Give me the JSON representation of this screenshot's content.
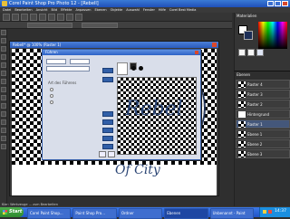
{
  "window": {
    "title": "Corel Paint Shop Pro Photo 12 - [Rebell]"
  },
  "menu": [
    "Datei",
    "Bearbeiten",
    "Ansicht",
    "Bild",
    "Effekte",
    "Anpassen",
    "Ebenen",
    "Objekte",
    "Auswahl",
    "Fenster",
    "Hilfe",
    "Corel Best Media"
  ],
  "document": {
    "title": "Rebell* @ 100% (Raster 1)"
  },
  "dialog": {
    "title": "Führen",
    "section": "Art des Führens"
  },
  "canvas_art": {
    "brand": "Rebel",
    "tagline": "Of City"
  },
  "palette": {
    "title": "Materialien"
  },
  "layers": {
    "title": "Ebenen",
    "items": [
      "Raster 4",
      "Raster 3",
      "Raster 2",
      "Hintergrund",
      "Raster 1",
      "Ebene 1",
      "Ebene 2",
      "Ebene 3"
    ]
  },
  "statusbar": {
    "text": "Klar: Werkzeuge ... zum Bearbeiten"
  },
  "taskbar": {
    "start": "Start",
    "tasks": [
      "Corel Paint Shop...",
      "Paint Shop Pro...",
      "Ordner",
      "Ebenen",
      "Unbenannt - Paint"
    ],
    "clock": "14:37"
  },
  "colors": {
    "accent": "#315fa8",
    "taskbar": "#245edb",
    "start": "#3c9a3c"
  }
}
